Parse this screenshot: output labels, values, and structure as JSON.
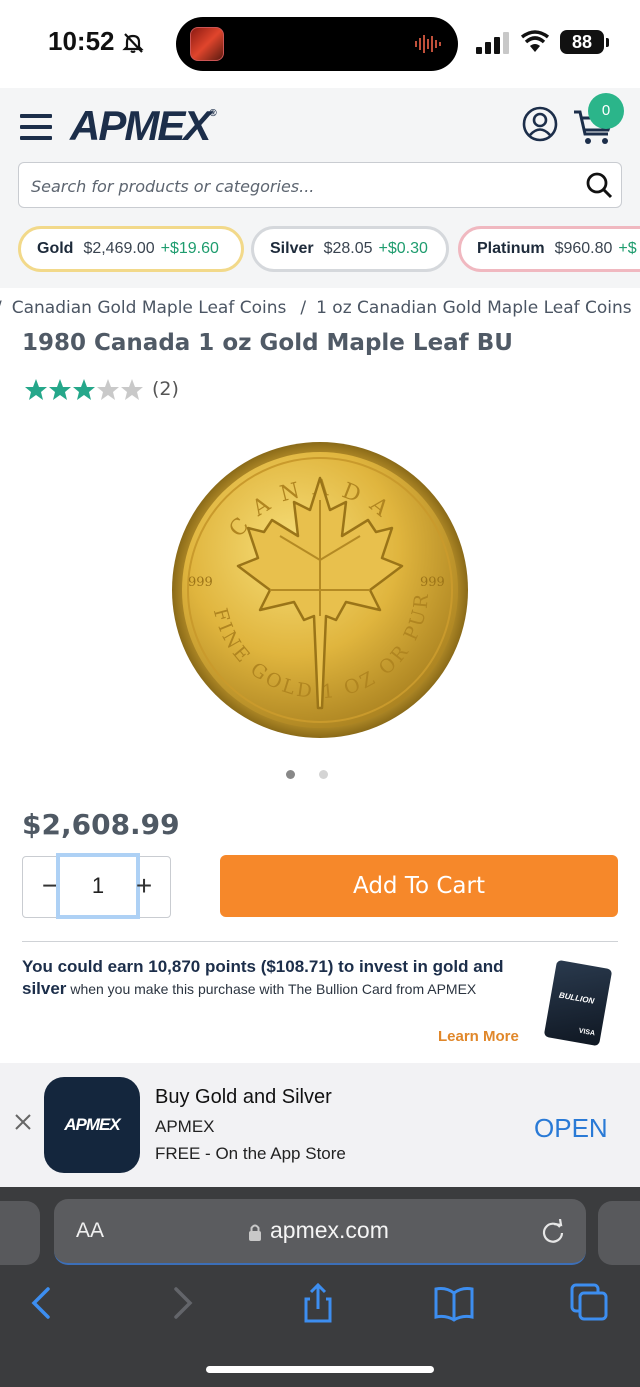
{
  "status": {
    "time": "10:52",
    "battery": "88"
  },
  "header": {
    "logo": "APMEX",
    "logo_mark": "®",
    "cart_count": "0",
    "search_placeholder": "Search for products or categories..."
  },
  "tickers": [
    {
      "name": "Gold",
      "price": "$2,469.00",
      "change": "+$19.60"
    },
    {
      "name": "Silver",
      "price": "$28.05",
      "change": "+$0.30"
    },
    {
      "name": "Platinum",
      "price": "$960.80",
      "change": "+$"
    }
  ],
  "breadcrumb": {
    "lead_sep": "/",
    "items": [
      "Canadian Gold Maple Leaf Coins",
      "1 oz Canadian Gold Maple Leaf Coins"
    ],
    "sep": "/"
  },
  "product": {
    "title": "1980 Canada 1 oz Gold Maple Leaf BU",
    "rating": 3,
    "rating_max": 5,
    "review_count": "(2)",
    "price": "$2,608.99",
    "quantity": "1",
    "add_to_cart": "Add To Cart",
    "coin": {
      "top_text": "CANADA",
      "left_purity": "999",
      "right_purity": "999",
      "bottom_text": "FINE GOLD 1 OZ OR PUR"
    },
    "image_pages": 2,
    "image_active": 1
  },
  "promo": {
    "bold": "You could earn 10,870 points ($108.71) to invest in gold and silver",
    "rest": " when you make this purchase with The Bullion Card from APMEX",
    "learn_more": "Learn More",
    "card_label": "BULLION",
    "card_network": "VISA"
  },
  "app_banner": {
    "icon_text": "APMEX",
    "title": "Buy Gold and Silver",
    "developer": "APMEX",
    "price_line": "FREE - On the App Store",
    "open": "OPEN"
  },
  "safari": {
    "aa": "AA",
    "url": "apmex.com"
  },
  "colors": {
    "brand_navy": "#1c2e4a",
    "accent_orange": "#f6882a",
    "positive_green": "#1e9c6e",
    "star_green": "#25a78a"
  }
}
